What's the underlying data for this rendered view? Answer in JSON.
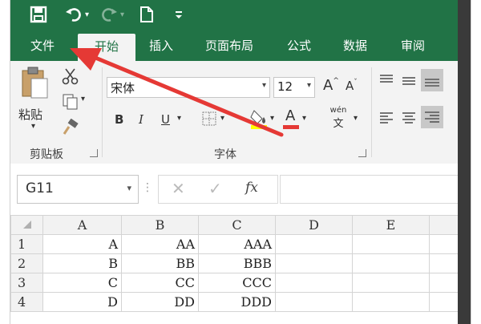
{
  "quick_access": {
    "save_icon": "save-icon",
    "undo_icon": "undo-icon",
    "redo_icon": "redo-icon",
    "new_icon": "new-document-icon",
    "customize_icon": "customize-dropdown-icon"
  },
  "tabs": [
    {
      "label": "文件"
    },
    {
      "label": "开始"
    },
    {
      "label": "插入"
    },
    {
      "label": "页面布局"
    },
    {
      "label": "公式"
    },
    {
      "label": "数据"
    },
    {
      "label": "审阅"
    }
  ],
  "ribbon": {
    "clipboard": {
      "paste_label": "粘贴",
      "group_label": "剪贴板"
    },
    "font": {
      "font_name": "宋体",
      "font_size": "12",
      "bold": "B",
      "italic": "I",
      "underline": "U",
      "font_color_letter": "A",
      "grow_font": "A",
      "shrink_font": "A",
      "phonetic_top": "wén",
      "phonetic_bottom": "文",
      "group_label": "字体"
    }
  },
  "formula_bar": {
    "name_box": "G11",
    "fx": "fx",
    "formula": ""
  },
  "sheet": {
    "columns": [
      "A",
      "B",
      "C",
      "D",
      "E"
    ],
    "rows": [
      {
        "num": "1",
        "cells": [
          "A",
          "AA",
          "AAA",
          "",
          ""
        ]
      },
      {
        "num": "2",
        "cells": [
          "B",
          "BB",
          "BBB",
          "",
          ""
        ]
      },
      {
        "num": "3",
        "cells": [
          "C",
          "CC",
          "CCC",
          "",
          ""
        ]
      },
      {
        "num": "4",
        "cells": [
          "D",
          "DD",
          "DDD",
          "",
          ""
        ]
      }
    ]
  },
  "colors": {
    "excel_green": "#217346",
    "annotation_arrow": "#e53935",
    "font_color_bar": "#e53935",
    "highlight_bar": "#ffff00"
  }
}
